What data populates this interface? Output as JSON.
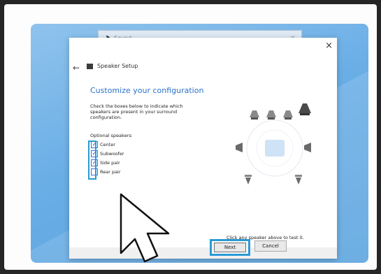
{
  "background_window": {
    "title": "Sound",
    "close": "×"
  },
  "dialog": {
    "close": "×",
    "back": "←",
    "title": "Speaker Setup",
    "heading": "Customize your configuration",
    "instructions": "Check the boxes below to indicate which speakers are present in your surround configuration.",
    "optional_label": "Optional speakers:",
    "options": [
      {
        "label": "Center",
        "checked": true
      },
      {
        "label": "Subwoofer",
        "checked": true
      },
      {
        "label": "Side pair",
        "checked": true
      },
      {
        "label": "Rear pair",
        "checked": false
      }
    ],
    "hint": "Click any speaker above to test it.",
    "next_label": "Next",
    "cancel_label": "Cancel"
  },
  "colors": {
    "accent": "#2b9ad4",
    "heading": "#2b73c9",
    "backdrop": "#6aaee6"
  }
}
